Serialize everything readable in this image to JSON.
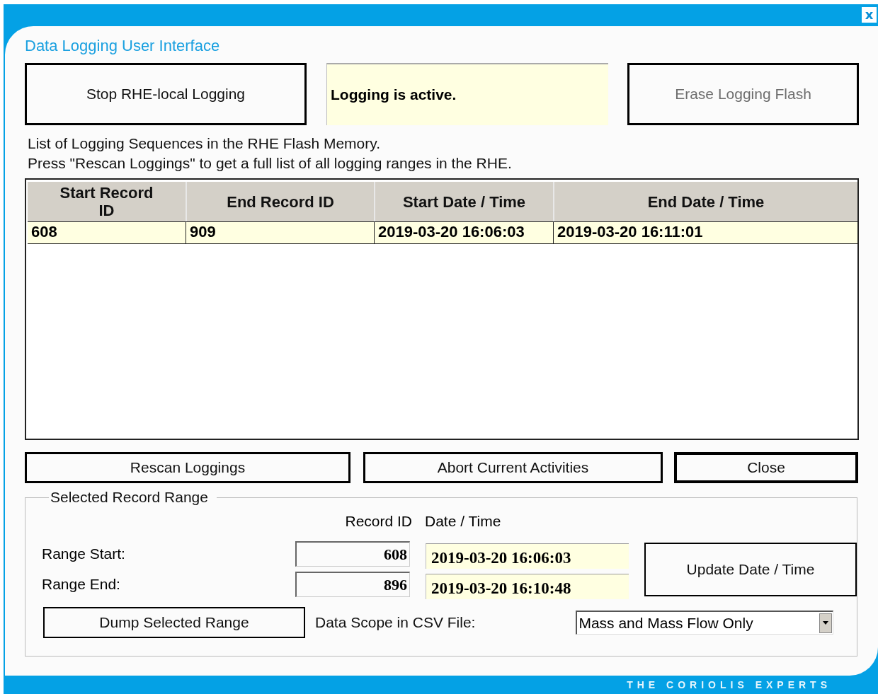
{
  "window": {
    "title": "Data Logging User Interface",
    "close_glyph": "x"
  },
  "logging_button": {
    "label": "Stop RHE-local Logging",
    "disabled": false
  },
  "status": {
    "text": "Logging is active."
  },
  "erase_button": {
    "label": "Erase Logging Flash",
    "disabled": true
  },
  "description": [
    "List of Logging Sequences in the RHE Flash Memory.",
    "Press \"Rescan Loggings\" to get a full list of all logging ranges in the RHE."
  ],
  "table": {
    "columns": [
      "Start Record ID",
      "End Record ID",
      "Start Date / Time",
      "End Date / Time"
    ],
    "rows": [
      {
        "cells": [
          "608",
          "909",
          "2019-03-20 16:06:03",
          "2019-03-20 16:11:01"
        ],
        "selected": true
      }
    ]
  },
  "buttons": [
    {
      "label": "Rescan Loggings",
      "default": false
    },
    {
      "label": "Abort Current Activities",
      "default": false
    },
    {
      "label": "Close",
      "default": true
    }
  ],
  "range": {
    "legend": "Selected Record Range",
    "column_headers": [
      "Record ID",
      "Date / Time"
    ],
    "rows": [
      {
        "label": "Range Start:",
        "record_id": "608",
        "date_time": "2019-03-20 16:06:03"
      },
      {
        "label": "Range End:",
        "record_id": "896",
        "date_time": "2019-03-20 16:10:48"
      }
    ],
    "update_button": "Update Date / Time",
    "dump_button": "Dump Selected Range",
    "scope_label": "Data Scope in CSV File:",
    "scope_value": "Mass and Mass Flow Only"
  },
  "footer": {
    "tagline": "THE CORIOLIS EXPERTS"
  }
}
